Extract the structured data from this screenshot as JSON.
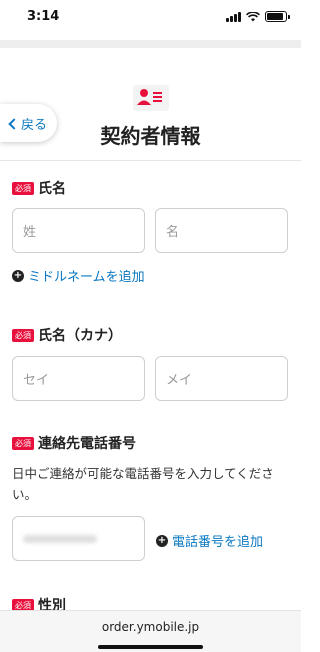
{
  "status_bar": {
    "time": "3:14",
    "battery_level": 0.9
  },
  "header": {
    "icon": "contact-card-icon",
    "back_label": "戻る",
    "title": "契約者情報"
  },
  "form": {
    "required_badge": "必須",
    "name": {
      "label": "氏名",
      "last_placeholder": "姓",
      "first_placeholder": "名",
      "add_middle_name": "ミドルネームを追加"
    },
    "name_kana": {
      "label": "氏名（カナ）",
      "last_placeholder": "セイ",
      "first_placeholder": "メイ"
    },
    "phone": {
      "label": "連絡先電話番号",
      "help": "日中ご連絡が可能な電話番号を入力してください。",
      "add_phone": "電話番号を追加"
    },
    "gender": {
      "label": "性別"
    }
  },
  "browser": {
    "url": "order.ymobile.jp"
  },
  "colors": {
    "accent": "#e8103c",
    "link": "#0a78c2"
  }
}
